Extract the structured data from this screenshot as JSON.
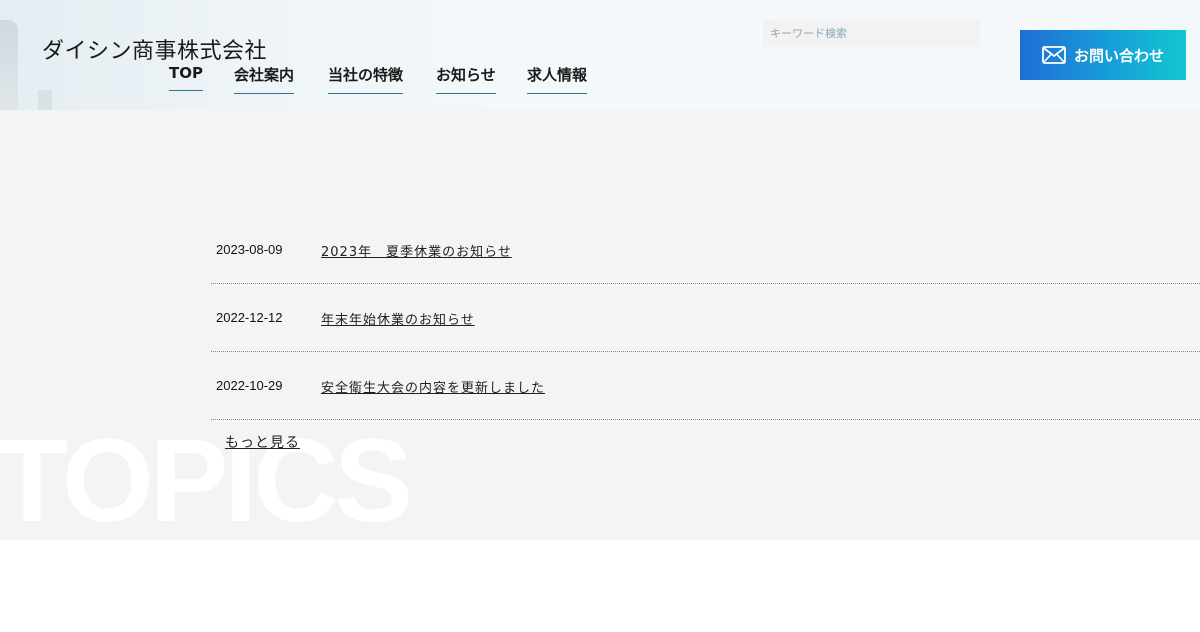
{
  "header": {
    "logo": "ダイシン商事株式会社",
    "nav": [
      {
        "label": "TOP"
      },
      {
        "label": "会社案内"
      },
      {
        "label": "当社の特徴"
      },
      {
        "label": "お知らせ"
      },
      {
        "label": "求人情報"
      }
    ],
    "search": {
      "placeholder": "キーワード検索",
      "value": ""
    },
    "contact_label": "お問い合わせ",
    "contact_icon": "mail-icon"
  },
  "topics": {
    "background_text": "TOPICS",
    "items": [
      {
        "date": "2023-08-09",
        "title": "2023年　夏季休業のお知らせ"
      },
      {
        "date": "2022-12-12",
        "title": "年末年始休業のお知らせ"
      },
      {
        "date": "2022-10-29",
        "title": "安全衛生大会の内容を更新しました"
      }
    ],
    "more_label": "もっと見る"
  },
  "colors": {
    "accent_gradient_start": "#1f6fd6",
    "accent_gradient_end": "#12c6d0",
    "nav_underline": "#2a7a86",
    "section_bg": "#f4f4f4"
  }
}
